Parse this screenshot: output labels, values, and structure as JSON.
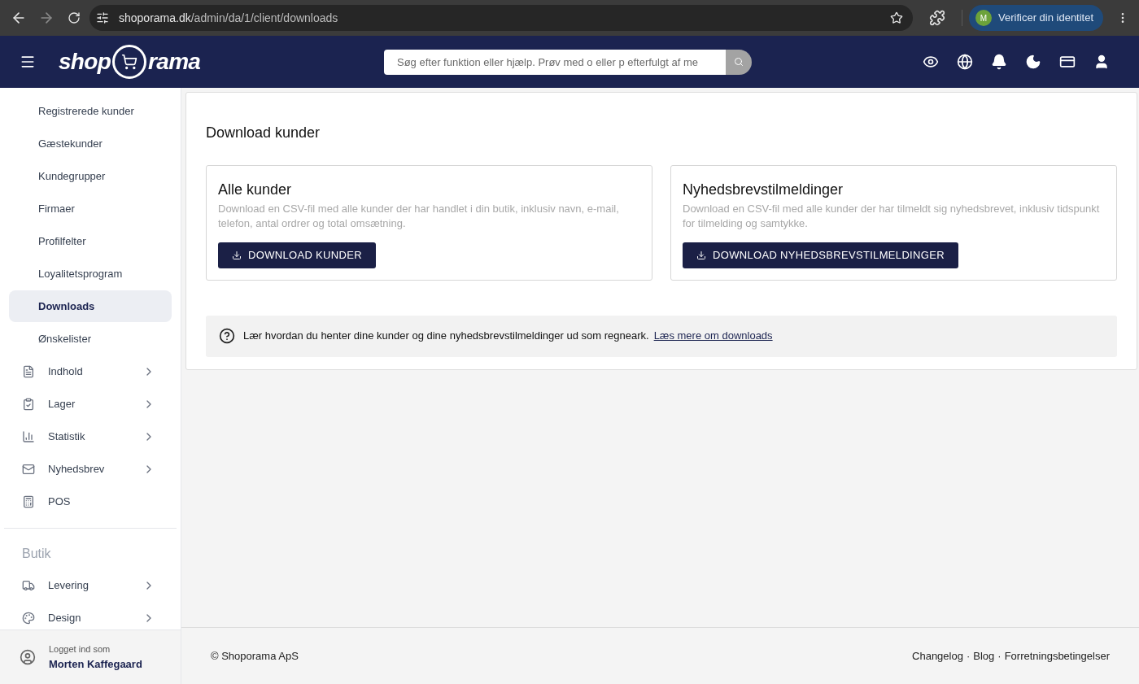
{
  "browser": {
    "url_host": "shoporama.dk",
    "url_path": "/admin/da/1/client/downloads",
    "profile_initial": "M",
    "profile_label": "Verificer din identitet"
  },
  "header": {
    "logo": {
      "left": "shop",
      "right": "rama"
    },
    "search": {
      "placeholder": "Søg efter funktion eller hjælp. Prøv med o eller p efterfulgt af me"
    },
    "icons": [
      {
        "kind": "eye"
      },
      {
        "kind": "globe"
      },
      {
        "kind": "bell"
      },
      {
        "kind": "moon"
      },
      {
        "kind": "card"
      },
      {
        "kind": "user"
      }
    ]
  },
  "sidebar": {
    "items": [
      {
        "label": "Registrerede kunder",
        "kind": "sub",
        "selected": false
      },
      {
        "label": "Gæstekunder",
        "kind": "sub",
        "selected": false
      },
      {
        "label": "Kundegrupper",
        "kind": "sub",
        "selected": false
      },
      {
        "label": "Firmaer",
        "kind": "sub",
        "selected": false
      },
      {
        "label": "Profilfelter",
        "kind": "sub",
        "selected": false
      },
      {
        "label": "Loyalitetsprogram",
        "kind": "sub",
        "selected": false
      },
      {
        "label": "Downloads",
        "kind": "sub",
        "selected": true
      },
      {
        "label": "Ønskelister",
        "kind": "sub",
        "selected": false
      },
      {
        "label": "Indhold",
        "kind": "section",
        "expandable": true,
        "selected": false
      },
      {
        "label": "Lager",
        "kind": "section",
        "expandable": true,
        "selected": false
      },
      {
        "label": "Statistik",
        "kind": "section",
        "expandable": true,
        "selected": false
      },
      {
        "label": "Nyhedsbrev",
        "kind": "section",
        "expandable": true,
        "selected": false
      },
      {
        "label": "POS",
        "kind": "section",
        "expandable": false,
        "selected": false
      },
      {
        "kind": "divider"
      },
      {
        "label": "Butik",
        "kind": "heading"
      },
      {
        "label": "Levering",
        "kind": "section",
        "expandable": true,
        "selected": false
      },
      {
        "label": "Design",
        "kind": "section",
        "expandable": true,
        "selected": false
      }
    ],
    "user": {
      "caption": "Logget ind som",
      "name": "Morten Kaffegaard"
    }
  },
  "main": {
    "title": "Download kunder",
    "cards": [
      {
        "title": "Alle kunder",
        "description": "Download en CSV-fil med alle kunder der har handlet i din butik, inklusiv navn, e-mail, telefon, antal ordrer og total omsætning.",
        "button": "DOWNLOAD KUNDER"
      },
      {
        "title": "Nyhedsbrevstilmeldinger",
        "description": "Download en CSV-fil med alle kunder der har tilmeldt sig nyhedsbrevet, inklusiv tidspunkt for tilmelding og samtykke.",
        "button": "DOWNLOAD NYHEDSBREVSTILMELDINGER"
      }
    ],
    "info": {
      "text": "Lær hvordan du henter dine kunder og dine nyhedsbrevstilmeldinger ud som regneark.",
      "link": "Læs mere om downloads"
    }
  },
  "footer": {
    "copyright": "© Shoporama ApS",
    "links": [
      "Changelog",
      "Blog",
      "Forretningsbetingelser"
    ],
    "separator": "·"
  }
}
